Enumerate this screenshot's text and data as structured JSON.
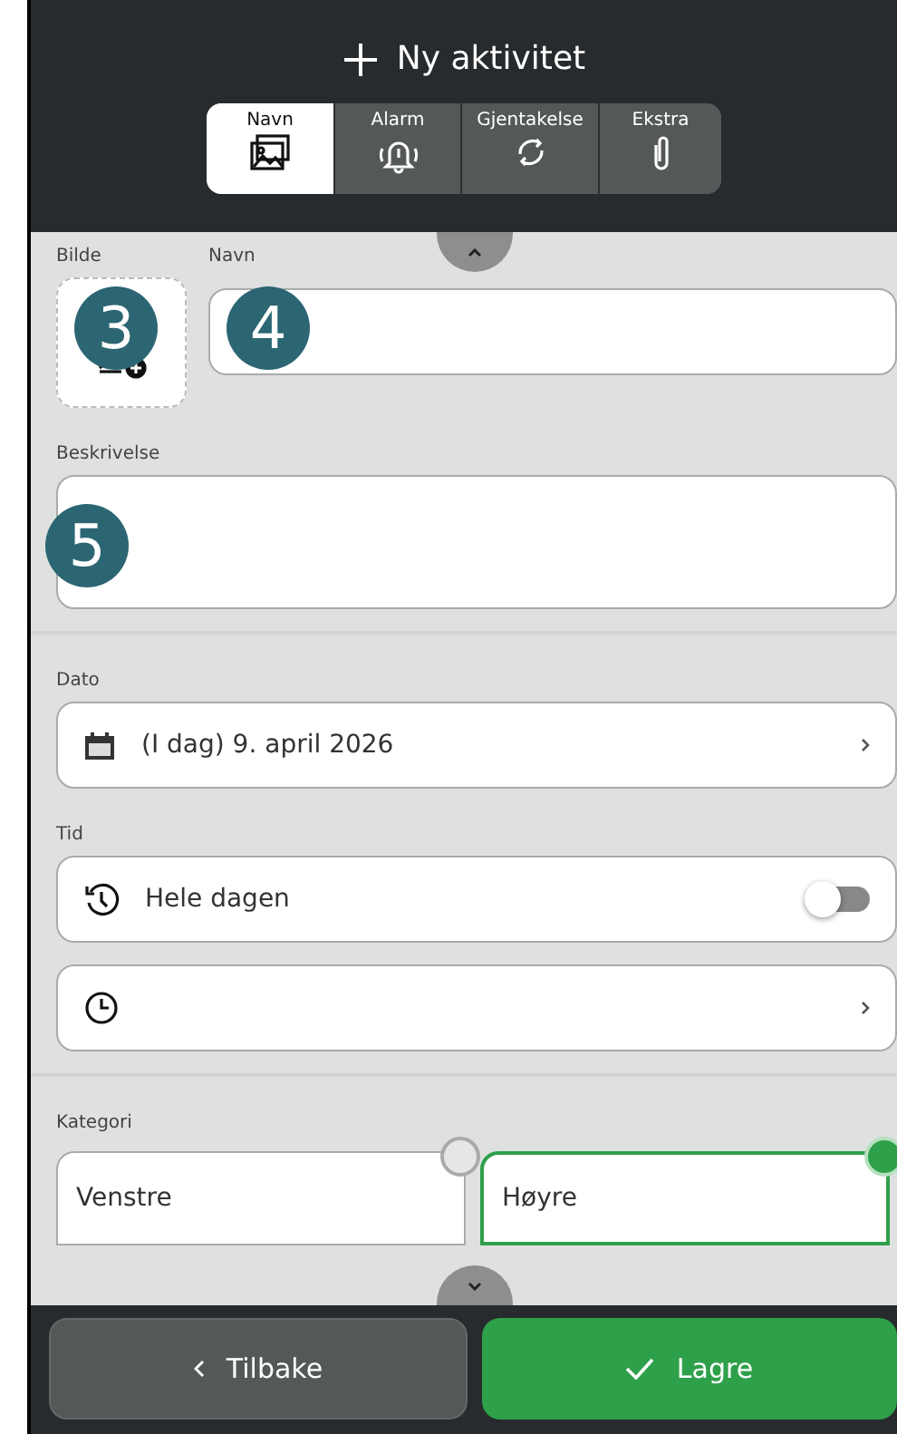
{
  "header": {
    "title": "Ny aktivitet"
  },
  "tabs": [
    {
      "label": "Navn",
      "kind": "image",
      "selected": true
    },
    {
      "label": "Alarm",
      "kind": "alarm",
      "selected": false
    },
    {
      "label": "Gjentakelse",
      "kind": "repeat",
      "selected": false
    },
    {
      "label": "Ekstra",
      "kind": "attach",
      "selected": false
    }
  ],
  "image_label": "Bilde",
  "name_label": "Navn",
  "description_label": "Beskrivelse",
  "markers": [
    "3",
    "4",
    "5"
  ],
  "date": {
    "label": "Dato",
    "value": "(I dag) 9. april 2026"
  },
  "time": {
    "label": "Tid",
    "all_day": {
      "label": "Hele dagen",
      "on": false
    }
  },
  "category": {
    "label": "Kategori",
    "options": [
      {
        "label": "Venstre",
        "selected": false
      },
      {
        "label": "Høyre",
        "selected": true
      }
    ]
  },
  "buttons": {
    "back": "Tilbake",
    "save": "Lagre"
  }
}
